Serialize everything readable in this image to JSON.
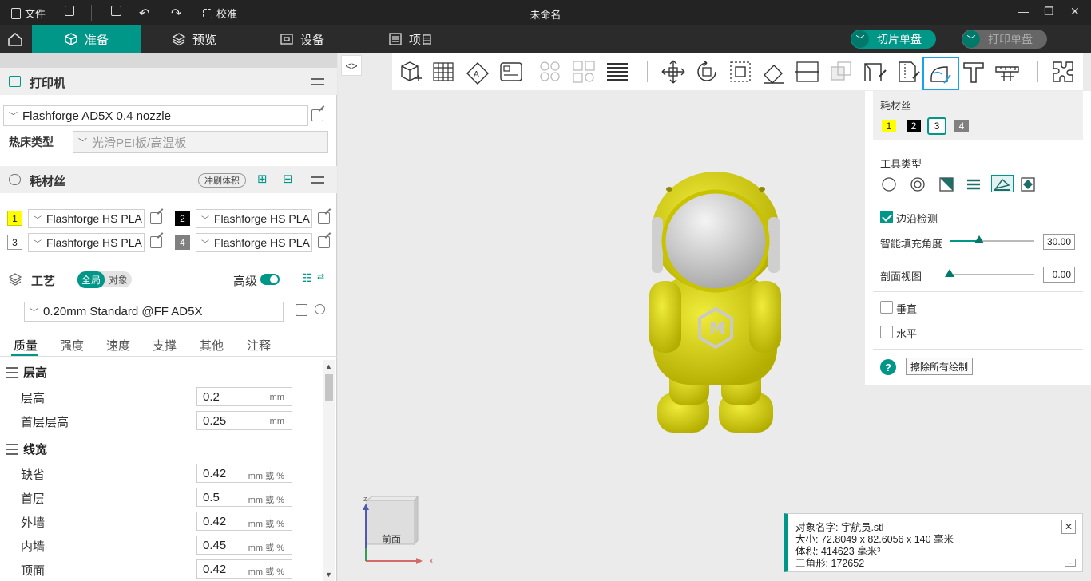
{
  "titlebar": {
    "file_label": "文件",
    "calibrate_label": "校准",
    "window_title": "未命名"
  },
  "nav": {
    "tabs": [
      {
        "label": "准备",
        "icon": "cube-icon"
      },
      {
        "label": "预览",
        "icon": "layers-icon"
      },
      {
        "label": "设备",
        "icon": "device-icon"
      },
      {
        "label": "项目",
        "icon": "list-icon"
      }
    ],
    "slice_button": "切片单盘",
    "print_button": "打印单盘"
  },
  "printer": {
    "section_title": "打印机",
    "printer_name": "Flashforge AD5X 0.4 nozzle",
    "bed_label": "热床类型",
    "bed_value": "光滑PEI板/高温板"
  },
  "filament": {
    "section_title": "耗材丝",
    "flush_button": "冲刷体积",
    "slots": [
      {
        "index": "1",
        "name": "Flashforge HS PLA",
        "color": "#ffff00"
      },
      {
        "index": "2",
        "name": "Flashforge HS PLA",
        "color": "#000000"
      },
      {
        "index": "3",
        "name": "Flashforge HS PLA",
        "color": "#ffffff"
      },
      {
        "index": "4",
        "name": "Flashforge HS PLA",
        "color": "#808080"
      }
    ]
  },
  "process": {
    "section_title": "工艺",
    "toggle_global": "全局",
    "toggle_object": "对象",
    "advanced_label": "高级",
    "profile": "0.20mm Standard @FF AD5X",
    "tabs": [
      "质量",
      "强度",
      "速度",
      "支撑",
      "其他",
      "注释"
    ],
    "groups": [
      {
        "title": "层高",
        "params": [
          {
            "label": "层高",
            "value": "0.2",
            "unit": "mm"
          },
          {
            "label": "首层层高",
            "value": "0.25",
            "unit": "mm"
          }
        ]
      },
      {
        "title": "线宽",
        "params": [
          {
            "label": "缺省",
            "value": "0.42",
            "unit": "mm 或 %"
          },
          {
            "label": "首层",
            "value": "0.5",
            "unit": "mm 或 %"
          },
          {
            "label": "外墙",
            "value": "0.42",
            "unit": "mm 或 %"
          },
          {
            "label": "内墙",
            "value": "0.45",
            "unit": "mm 或 %"
          },
          {
            "label": "顶面",
            "value": "0.42",
            "unit": "mm 或 %"
          }
        ]
      }
    ]
  },
  "paint_panel": {
    "filament_label": "耗材丝",
    "filament_indices": [
      "1",
      "2",
      "3",
      "4"
    ],
    "selected_filament": "3",
    "tool_type_label": "工具类型",
    "tool_types": [
      "circle-tool-icon",
      "sphere-tool-icon",
      "triangle-tool-icon",
      "height-range-tool-icon",
      "fill-tool-icon",
      "gap-fill-tool-icon"
    ],
    "edge_detect_label": "边沿检测",
    "smart_fill_label": "智能填充角度",
    "smart_fill_value": "30.00",
    "smart_fill_fraction": 0.35,
    "section_view_label": "剖面视图",
    "section_view_value": "0.00",
    "section_view_fraction": 0.0,
    "vertical_label": "垂直",
    "horizontal_label": "水平",
    "clear_button": "擦除所有绘制",
    "help_glyph": "?"
  },
  "object_info": {
    "name_line": "对象名字:  宇航员.stl",
    "size_line": "大小:   72.8049 x 82.6056 x 140 毫米",
    "volume_line": "体积:   414623 毫米³",
    "triangles_line": "三角形:  172652"
  },
  "view_cube": {
    "face_label": "前面",
    "x_axis": "x",
    "z_axis": "z"
  },
  "colors": {
    "accent": "#009688",
    "accent_dark": "#00796b",
    "selected_tool_border": "#1aa3e8",
    "model_yellow": "#d6d100",
    "model_visor": "#d9d9d9"
  }
}
